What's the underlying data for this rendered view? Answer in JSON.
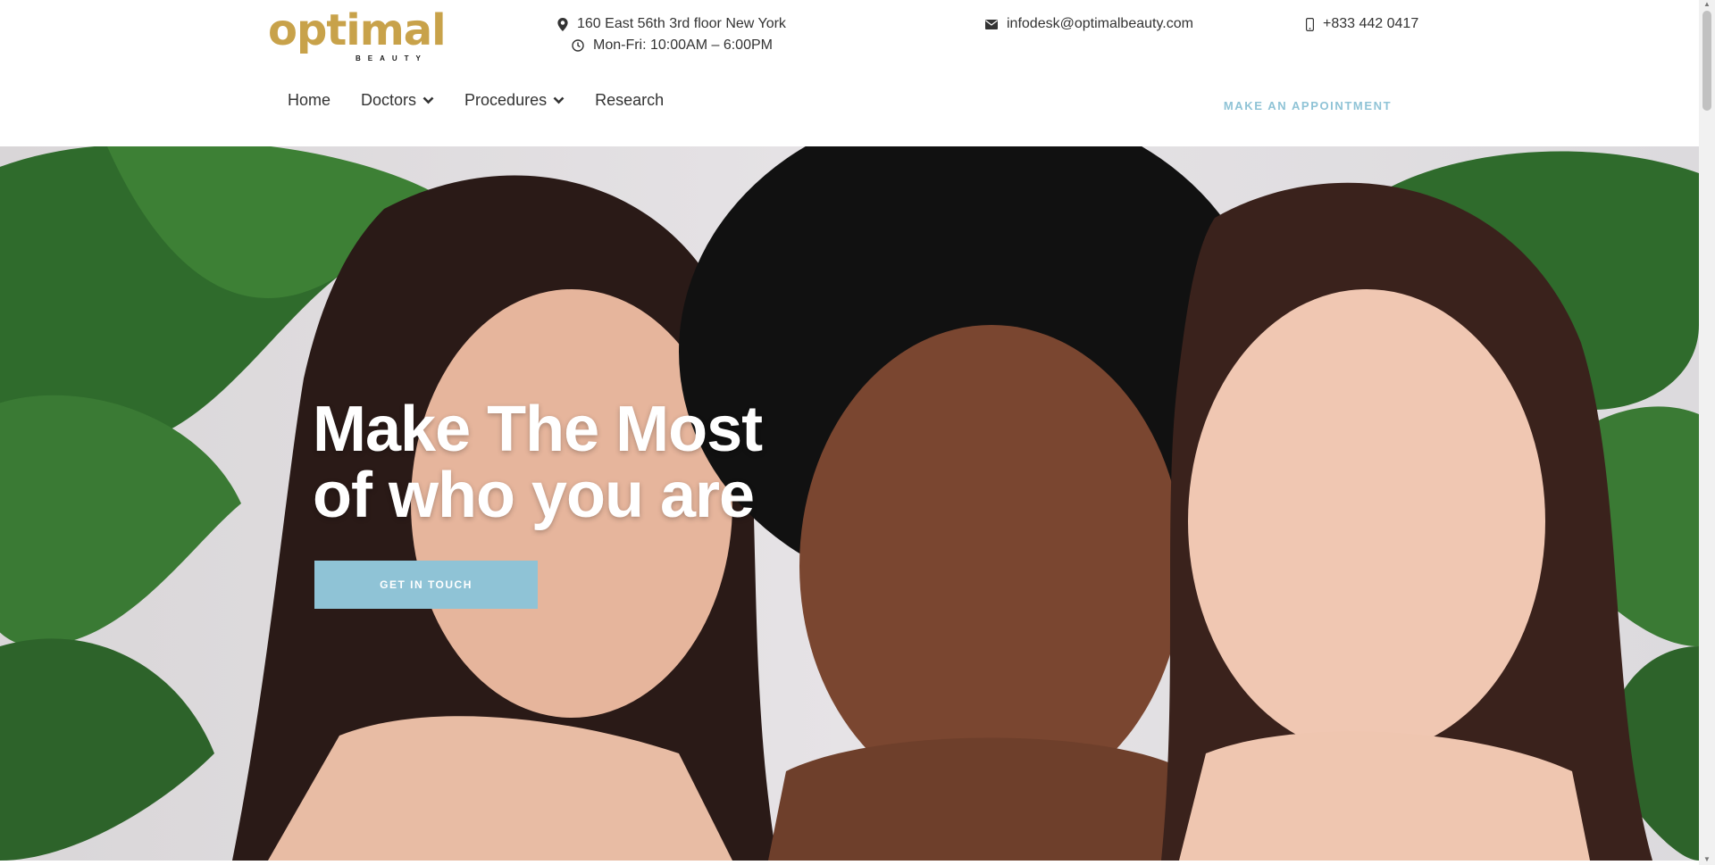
{
  "brand": {
    "name": "optimal",
    "subtitle": "BEAUTY",
    "color": "#c8a24a"
  },
  "contact": {
    "address": "160 East 56th 3rd floor New York",
    "hours": "Mon-Fri: 10:00AM – 6:00PM",
    "email": "infodesk@optimalbeauty.com",
    "phone": "+833 442 0417"
  },
  "nav": {
    "items": [
      {
        "label": "Home"
      },
      {
        "label": "Doctors",
        "dropdown": true
      },
      {
        "label": "Procedures",
        "dropdown": true
      },
      {
        "label": "Research"
      }
    ],
    "appointment": "MAKE AN APPOINTMENT"
  },
  "hero": {
    "headline_line1": "Make The Most",
    "headline_line2": "of who you are",
    "cta": "GET IN TOUCH"
  },
  "colors": {
    "accent": "#8fc3d6",
    "gold": "#c8a24a",
    "text": "#333333"
  },
  "icons": [
    "map-pin-icon",
    "clock-icon",
    "envelope-icon",
    "mobile-phone-icon",
    "chevron-down-icon"
  ]
}
